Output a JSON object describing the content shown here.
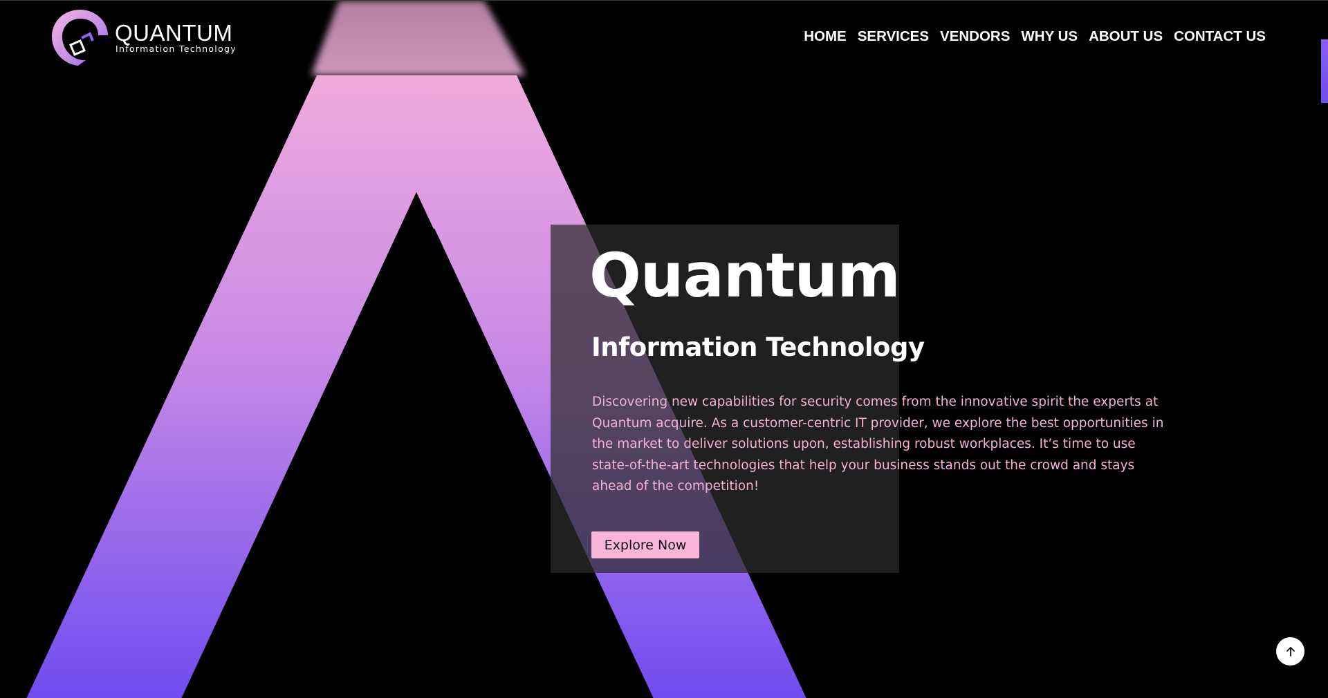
{
  "brand": {
    "name": "QUANTUM",
    "tagline": "Information Technology",
    "colors": {
      "pink": "#f9b4d9",
      "violet": "#6d4cf0",
      "text_pink": "#f4b2d6"
    }
  },
  "nav": {
    "items": [
      {
        "label": "HOME"
      },
      {
        "label": "SERVICES"
      },
      {
        "label": "VENDORS"
      },
      {
        "label": "WHY US"
      },
      {
        "label": "ABOUT US"
      },
      {
        "label": "CONTACT US"
      }
    ]
  },
  "hero": {
    "title": "Quantum",
    "subtitle": "Information Technology",
    "description": "Discovering new capabilities for security comes from the innovative spirit the experts at Quantum acquire. As a customer-centric IT provider, we explore the best opportunities in the market to deliver solutions upon, establishing robust workplaces. It’s time to use state-of-the-art technologies that help your business stands out the crowd and stays ahead of the competition!",
    "cta_label": "Explore Now"
  },
  "icons": {
    "logo": "quantum-q-logo-icon",
    "back_to_top": "arrow-up-icon"
  }
}
